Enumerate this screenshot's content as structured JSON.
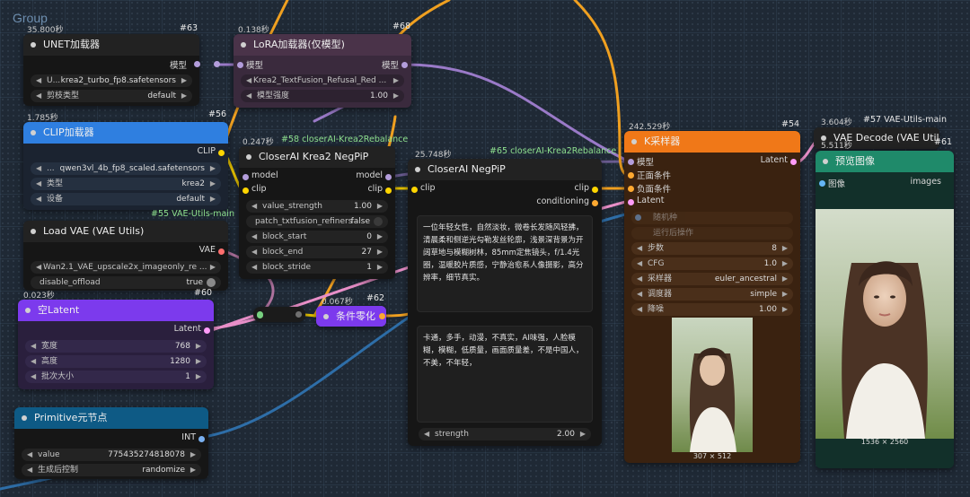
{
  "group": {
    "title": "Group"
  },
  "colors": {
    "model": "#b39ddb",
    "clip": "#ffd500",
    "vae": "#ff6e6e",
    "latent": "#ff9cf9",
    "conditioning": "#ffa931",
    "int": "#7ab0f0",
    "image": "#64b5f6",
    "wire_orange": "#f0a020",
    "wire_blue": "#2e6ea8",
    "wire_purple": "#9a7ac8",
    "wire_pink": "#e88fc8",
    "wire_yellow": "#e6c200",
    "wire_green": "#6aba7a"
  },
  "nodes": {
    "unet": {
      "id": "#63",
      "timing": "35.800秒",
      "title": "UNET加载器",
      "out_label": "模型",
      "widgets": [
        {
          "label": "U...",
          "value": "krea2_turbo_fp8.safetensors"
        },
        {
          "label": "剪枝类型",
          "value": "default"
        }
      ]
    },
    "lora": {
      "id": "#68",
      "timing": "0.138秒",
      "title": "LoRA加载器(仅模型)",
      "in_label": "模型",
      "out_label": "模型",
      "widgets": [
        {
          "label": "",
          "value": "Krea2_TextFusion_Refusal_Red ..."
        },
        {
          "label": "模型强度",
          "value": "1.00"
        }
      ]
    },
    "clip": {
      "id": "#56",
      "timing": "1.785秒",
      "title": "CLIP加载器",
      "out_label": "CLIP",
      "footer": "#55 VAE-Utils-main",
      "widgets": [
        {
          "label": "...",
          "value": "qwen3vl_4b_fp8_scaled.safetensors"
        },
        {
          "label": "类型",
          "value": "krea2"
        },
        {
          "label": "设备",
          "value": "default"
        }
      ]
    },
    "closer_krea": {
      "id": "#58 closerAI-Krea2Rebalance",
      "timing": "0.247秒",
      "title": "CloserAI Krea2 NegPiP",
      "inputs": [
        "model",
        "clip"
      ],
      "outputs": [
        "model",
        "clip"
      ],
      "widgets": [
        {
          "label": "value_strength",
          "value": "1.00"
        },
        {
          "label": "patch_txtfusion_refiners",
          "value": "false",
          "toggle": true
        },
        {
          "label": "block_start",
          "value": "0"
        },
        {
          "label": "block_end",
          "value": "27"
        },
        {
          "label": "block_stride",
          "value": "1"
        }
      ]
    },
    "vae": {
      "title": "Load VAE (VAE Utils)",
      "out_label": "VAE",
      "widgets": [
        {
          "label": "",
          "value": "Wan2.1_VAE_upscale2x_imageonly_re ..."
        },
        {
          "label": "disable_offload",
          "value": "true",
          "toggle": true
        }
      ]
    },
    "latent": {
      "id": "#60",
      "timing": "0.023秒",
      "title": "空Latent",
      "out_label": "Latent",
      "widgets": [
        {
          "label": "宽度",
          "value": "768"
        },
        {
          "label": "高度",
          "value": "1280"
        },
        {
          "label": "批次大小",
          "value": "1"
        }
      ]
    },
    "cond_zero": {
      "id": "#62",
      "timing": "0.067秒",
      "title": "条件零化"
    },
    "primitive": {
      "title": "Primitive元节点",
      "out_label": "INT",
      "widgets": [
        {
          "label": "value",
          "value": "775435274818078"
        },
        {
          "label": "生成后控制",
          "value": "randomize"
        }
      ]
    },
    "negpip": {
      "id": "#65 closerAI-Krea2Rebalance",
      "timing": "25.748秒",
      "title": "CloserAI NegPiP",
      "in_label": "clip",
      "outputs": [
        "clip",
        "conditioning"
      ],
      "positive_text": "一位年轻女性，自然淡妆，微卷长发随风轻拂，清晨柔和侧逆光勾勒发丝轮廓，浅景深背景为开阔草地与模糊树林，85mm定焦镜头，f/1.4光圈，温暖胶片质感，宁静治愈系人像摄影，高分辨率，细节真实。",
      "negative_text": "卡通，多手，动漫，不真实，AI味强，人脸模糊，模糊，低质量，画面质量差，不是中国人，不美，不年轻，",
      "strength_label": "strength",
      "strength_value": "2.00"
    },
    "ksampler": {
      "id": "#54",
      "timing": "242.529秒",
      "title": "K采样器",
      "inputs": [
        "模型",
        "正面条件",
        "负面条件",
        "Latent"
      ],
      "out_label": "Latent",
      "disabled_widgets": [
        "随机种",
        "运行后操作"
      ],
      "widgets": [
        {
          "label": "步数",
          "value": "8"
        },
        {
          "label": "CFG",
          "value": "1.0"
        },
        {
          "label": "采样器",
          "value": "euler_ancestral"
        },
        {
          "label": "调度器",
          "value": "simple"
        },
        {
          "label": "降噪",
          "value": "1.00"
        }
      ],
      "preview_caption": "307 × 512"
    },
    "vae_decode": {
      "id": "#57 VAE-Utils-main",
      "timing": "3.604秒",
      "title": "VAE Decode (VAE Util"
    },
    "preview": {
      "id": "#61",
      "timing": "5.511秒",
      "title": "预览图像",
      "in_label": "图像",
      "out_label": "images",
      "caption": "1536 × 2560"
    }
  }
}
